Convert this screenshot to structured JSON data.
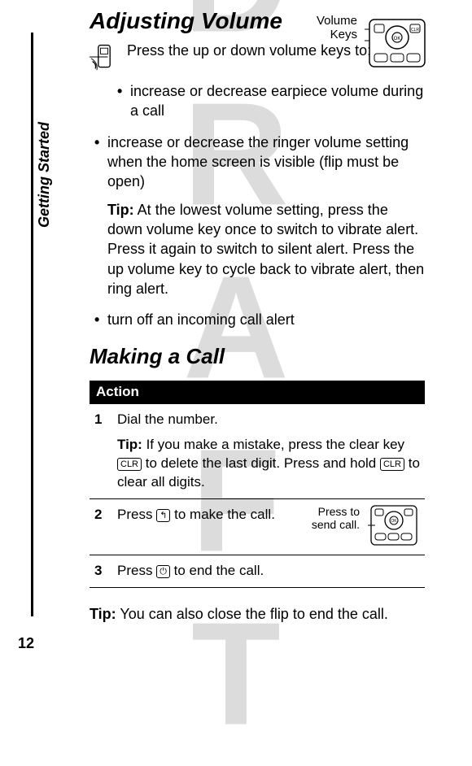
{
  "watermark": "DRAFT",
  "side_label": "Getting Started",
  "page_number": "12",
  "section1": {
    "title": "Adjusting Volume",
    "intro": "Press the up or down volume keys to:",
    "volume_label_1": "Volume",
    "volume_label_2": "Keys",
    "bullets": [
      "increase or decrease earpiece volume during a call",
      "increase or decrease the ringer volume setting when the home screen is visible (flip must be open)",
      "turn off an incoming call alert"
    ],
    "tip_label": "Tip:",
    "tip_body": " At the lowest volume setting, press the down volume key once to switch to vibrate alert. Press it again to switch to silent alert. Press the up volume key to cycle back to vibrate alert, then ring alert."
  },
  "section2": {
    "title": "Making a Call",
    "action_header": "Action",
    "steps": {
      "s1_num": "1",
      "s1_text": "Dial the number.",
      "s1_tip_label": "Tip:",
      "s1_tip_a": " If you make a mistake, press the clear key ",
      "s1_tip_b": " to delete the last digit. Press and hold ",
      "s1_tip_c": " to clear all digits.",
      "clr_key": "CLR",
      "s2_num": "2",
      "s2_text_a": "Press ",
      "s2_text_b": " to make the call.",
      "send_key": "↰",
      "s2_callout_1": "Press to",
      "s2_callout_2": "send call.",
      "s3_num": "3",
      "s3_text_a": "Press ",
      "s3_text_b": " to end the call.",
      "end_key": "⏻"
    },
    "closing_tip_label": "Tip:",
    "closing_tip": " You can also close the flip to end the call."
  }
}
